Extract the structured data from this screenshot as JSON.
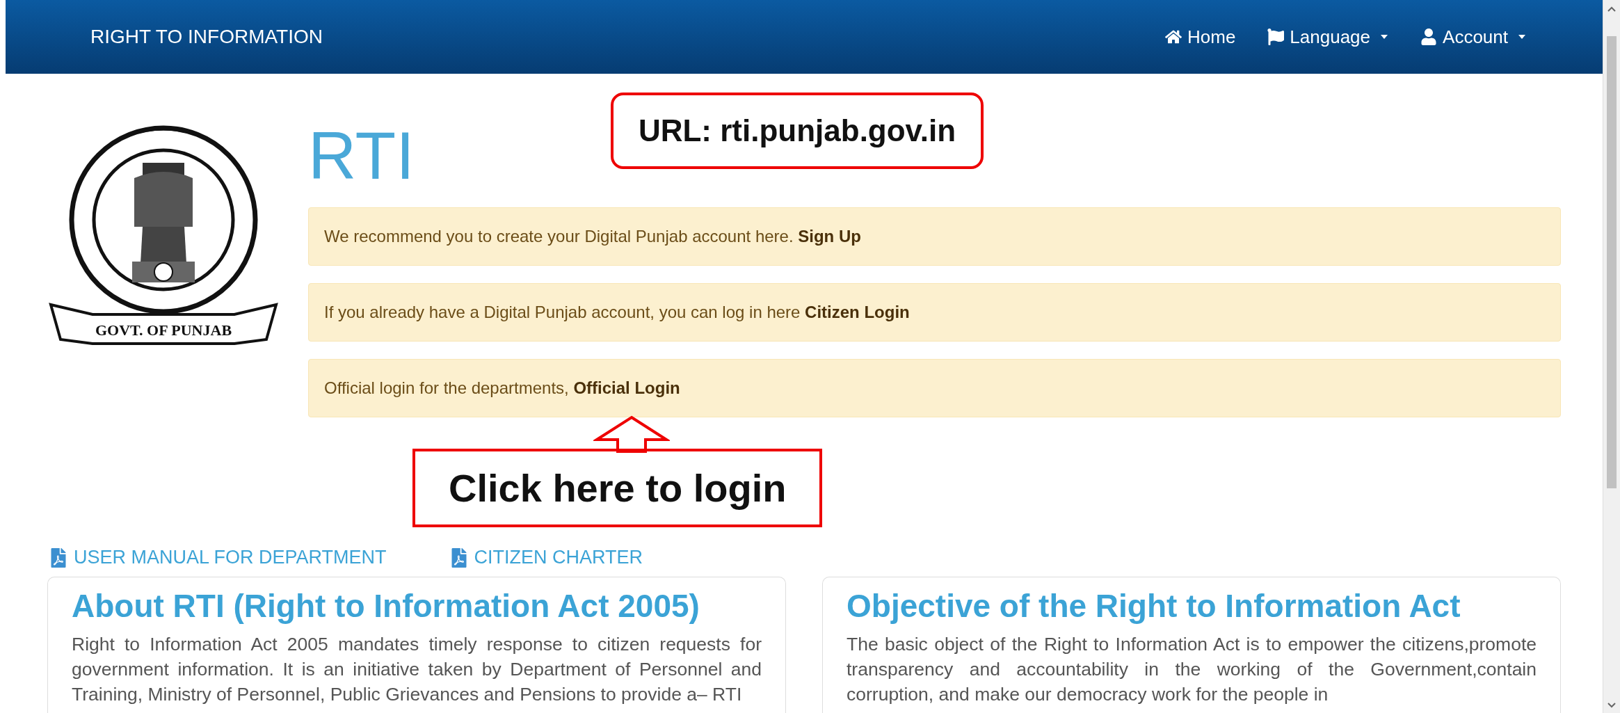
{
  "navbar": {
    "brand": "RIGHT TO INFORMATION",
    "items": [
      {
        "kind": "link",
        "label": "Home"
      },
      {
        "kind": "dropdown",
        "label": "Language"
      },
      {
        "kind": "dropdown",
        "label": "Account"
      }
    ]
  },
  "emblem": {
    "ribbon": "GOVT. OF PUNJAB"
  },
  "title": "RTI",
  "url_callout": "URL: rti.punjab.gov.in",
  "alerts": [
    {
      "text": "We recommend you to create your Digital Punjab account here.",
      "link": "Sign Up"
    },
    {
      "text": "If you already have a Digital Punjab account, you can log in here",
      "link": "Citizen Login"
    },
    {
      "text": "Official login for the departments,",
      "link": "Official Login"
    }
  ],
  "login_callout": "Click here to login",
  "documents": [
    {
      "label": "USER MANUAL FOR DEPARTMENT"
    },
    {
      "label": "CITIZEN CHARTER"
    }
  ],
  "cards": [
    {
      "heading": "About RTI (Right to Information Act 2005)",
      "body": "Right to Information Act 2005 mandates timely response to citizen requests for government information. It is an initiative taken by Department of Personnel and Training, Ministry of Personnel, Public Grievances and Pensions to provide a– RTI"
    },
    {
      "heading": "Objective of the Right to Information Act",
      "body": "The basic object of the Right to Information Act is to empower the citizens,promote transparency and accountability in the working of the Government,contain corruption, and make our democracy work for the people in"
    }
  ]
}
